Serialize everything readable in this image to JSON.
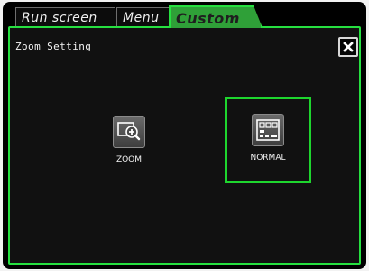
{
  "tabs": [
    {
      "label": "Run screen"
    },
    {
      "label": "Menu"
    },
    {
      "label": "Custom"
    }
  ],
  "panel": {
    "title": "Zoom Setting",
    "close_icon": "close-icon"
  },
  "options": [
    {
      "label": "ZOOM",
      "icon": "zoom-icon",
      "selected": false
    },
    {
      "label": "NORMAL",
      "icon": "layout-grid-icon",
      "selected": true
    }
  ],
  "colors": {
    "accent": "#26e040",
    "selected_outline": "#1ed62e",
    "panel_bg": "#111111",
    "tab_active_bg": "#2fa038"
  }
}
